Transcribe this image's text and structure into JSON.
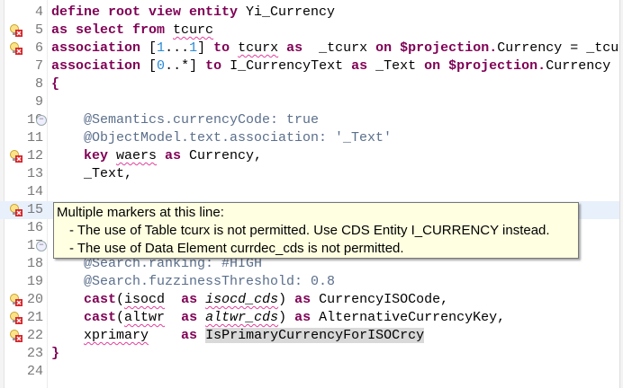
{
  "colors": {
    "keyword": "#7f0055",
    "annotation": "#5b6f8c",
    "number": "#2a8ad4",
    "current_line": "#e8f0fb",
    "tooltip_bg": "#ffffe1"
  },
  "lines": [
    {
      "n": "4",
      "tokens": [
        [
          "kw",
          "define root view entity "
        ],
        [
          "",
          "Yi_Currency"
        ]
      ]
    },
    {
      "n": "5",
      "marker": "warning-error",
      "tokens": [
        [
          "kw",
          "as select from "
        ],
        [
          "sq",
          "tcurc"
        ]
      ]
    },
    {
      "n": "6",
      "marker": "warning-error",
      "tokens": [
        [
          "kw",
          "association "
        ],
        [
          "",
          "["
        ],
        [
          "num",
          "1"
        ],
        [
          "",
          "..."
        ],
        [
          "num",
          "1"
        ],
        [
          "",
          "] "
        ],
        [
          "kw",
          "to "
        ],
        [
          "sq",
          "tcurx"
        ],
        [
          "kw",
          " as  "
        ],
        [
          "",
          "_tcurx "
        ],
        [
          "kw",
          "on $projection."
        ],
        [
          "",
          "Currency = _tcur"
        ]
      ]
    },
    {
      "n": "7",
      "tokens": [
        [
          "kw",
          "association "
        ],
        [
          "",
          "["
        ],
        [
          "num",
          "0"
        ],
        [
          "",
          "..*] "
        ],
        [
          "kw",
          "to "
        ],
        [
          "",
          "I_CurrencyText "
        ],
        [
          "kw",
          "as "
        ],
        [
          "",
          "_Text "
        ],
        [
          "kw",
          "on $projection."
        ],
        [
          "",
          "Currency"
        ]
      ]
    },
    {
      "n": "8",
      "tokens": [
        [
          "kw",
          "{"
        ]
      ]
    },
    {
      "n": "9",
      "tokens": []
    },
    {
      "n": "10",
      "fold": true,
      "tokens": [
        [
          "anno",
          "    @Semantics.currencyCode: true"
        ]
      ]
    },
    {
      "n": "11",
      "tokens": [
        [
          "anno",
          "    @ObjectModel.text.association: '_Text'"
        ]
      ]
    },
    {
      "n": "12",
      "marker": "warning-error",
      "tokens": [
        [
          "kw",
          "    key "
        ],
        [
          "sq",
          "waers"
        ],
        [
          "kw",
          " as "
        ],
        [
          "",
          "Currency,"
        ]
      ]
    },
    {
      "n": "13",
      "tokens": [
        [
          "",
          "    _Text,"
        ]
      ]
    },
    {
      "n": "14",
      "tokens": []
    },
    {
      "n": "15",
      "marker": "warning-error",
      "current": true,
      "tokens": []
    },
    {
      "n": "16",
      "tokens": []
    },
    {
      "n": "17",
      "fold": true,
      "tokens": []
    },
    {
      "n": "18",
      "tokens": [
        [
          "anno",
          "    @Search.ranking: #HIGH"
        ]
      ]
    },
    {
      "n": "19",
      "tokens": [
        [
          "anno",
          "    @Search.fuzzinessThreshold: 0.8"
        ]
      ]
    },
    {
      "n": "20",
      "marker": "warning-error",
      "tokens": [
        [
          "kw",
          "    cast"
        ],
        [
          "",
          "("
        ],
        [
          "sq",
          "isocd"
        ],
        [
          "",
          "  "
        ],
        [
          "kw",
          "as "
        ],
        [
          "sq it",
          "isocd_cds"
        ],
        [
          "",
          ") "
        ],
        [
          "kw",
          "as "
        ],
        [
          "",
          "CurrencyISOCode,"
        ]
      ]
    },
    {
      "n": "21",
      "marker": "warning-error",
      "tokens": [
        [
          "kw",
          "    cast"
        ],
        [
          "",
          "("
        ],
        [
          "sq",
          "altwr"
        ],
        [
          "",
          "  "
        ],
        [
          "kw",
          "as "
        ],
        [
          "sq it",
          "altwr_cds"
        ],
        [
          "",
          ") "
        ],
        [
          "kw",
          "as "
        ],
        [
          "",
          "AlternativeCurrencyKey,"
        ]
      ]
    },
    {
      "n": "22",
      "marker": "warning-error",
      "tokens": [
        [
          "",
          "    "
        ],
        [
          "sq",
          "xprimary"
        ],
        [
          "",
          "    "
        ],
        [
          "kw",
          "as "
        ],
        [
          "sel",
          "IsPrimaryCurrencyForISOCrcy"
        ]
      ]
    },
    {
      "n": "23",
      "tokens": [
        [
          "kw",
          "}"
        ]
      ]
    },
    {
      "n": "24",
      "tokens": []
    }
  ],
  "tooltip": {
    "title": "Multiple markers at this line:",
    "items": [
      "- The use of Table tcurx is not permitted. Use CDS Entity I_CURRENCY instead.",
      "- The use of Data Element currdec_cds is not permitted."
    ]
  }
}
